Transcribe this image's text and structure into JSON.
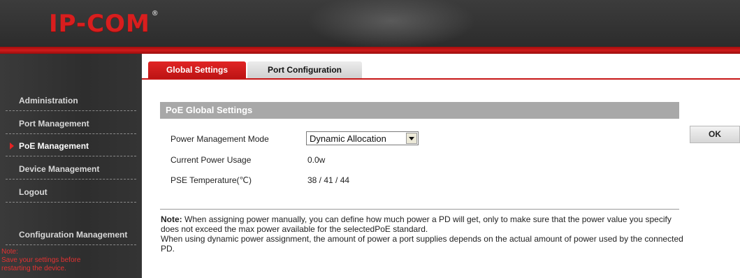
{
  "header": {
    "logo_text": "IP-COM",
    "logo_mark": "®"
  },
  "sidebar": {
    "items": [
      {
        "label": "Administration",
        "active": false
      },
      {
        "label": "Port Management",
        "active": false
      },
      {
        "label": "PoE Management",
        "active": true
      },
      {
        "label": "Device Management",
        "active": false
      },
      {
        "label": "Logout",
        "active": false
      },
      {
        "label": "Configuration Management",
        "active": false
      }
    ],
    "note": {
      "title": "Note:",
      "line1": "Save your settings before",
      "line2": "restarting the device."
    }
  },
  "tabs": [
    {
      "label": "Global Settings",
      "selected": true
    },
    {
      "label": "Port Configuration",
      "selected": false
    }
  ],
  "section": {
    "title": "PoE Global Settings",
    "rows": [
      {
        "label": "Power Management Mode",
        "value": "Dynamic Allocation"
      },
      {
        "label": "Current Power Usage",
        "value": "0.0w"
      },
      {
        "label": "PSE Temperature(℃)",
        "value": "38 / 41 / 44"
      }
    ]
  },
  "ok_button": "OK",
  "note": {
    "title": "Note:",
    "line1": " When assigning power manually, you can define how much power a PD will get, only to make sure that the power value you specify does not exceed the max power available for the selectedPoE standard.",
    "line2": "When using dynamic power assignment, the amount of power a port supplies depends on the actual amount of power used by the connected PD."
  },
  "colors": {
    "accent": "#cf1b1b",
    "sidebar_bg": "#333333",
    "section_header": "#a8a8a8"
  }
}
